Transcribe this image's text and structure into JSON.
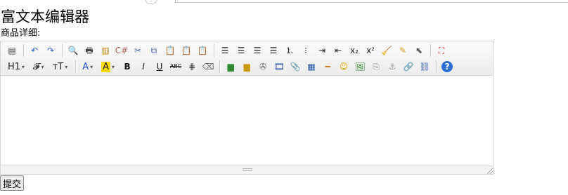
{
  "page": {
    "title": "富文本编辑器",
    "field_label": "商品详细:"
  },
  "editor": {
    "toolbar": {
      "row1": [
        {
          "name": "source-icon",
          "glyph": "▤",
          "color": "#444"
        },
        {
          "sep": true
        },
        {
          "name": "undo-icon",
          "glyph": "↶",
          "color": "#2a62c9"
        },
        {
          "name": "redo-icon",
          "glyph": "↷",
          "color": "#2a62c9"
        },
        {
          "sep": true
        },
        {
          "name": "preview-icon",
          "glyph": "🔍",
          "color": "#666"
        },
        {
          "name": "print-icon",
          "glyph": "🖶",
          "color": "#444"
        },
        {
          "name": "template-icon",
          "glyph": "▥",
          "color": "#c98a12"
        },
        {
          "name": "code-icon",
          "glyph": "C#",
          "color": "#b66"
        },
        {
          "name": "cut-icon",
          "glyph": "✂",
          "color": "#4b6fb8"
        },
        {
          "name": "copy-icon",
          "glyph": "⧉",
          "color": "#4b6fb8"
        },
        {
          "name": "paste-icon",
          "glyph": "📋",
          "color": "#a8731c"
        },
        {
          "name": "paste-text-icon",
          "glyph": "📋",
          "color": "#a8731c"
        },
        {
          "name": "paste-word-icon",
          "glyph": "📋",
          "color": "#2b56a8"
        },
        {
          "sep": true
        },
        {
          "name": "align-left-icon",
          "glyph": "☰",
          "color": "#222"
        },
        {
          "name": "align-center-icon",
          "glyph": "☰",
          "color": "#222"
        },
        {
          "name": "align-right-icon",
          "glyph": "☰",
          "color": "#222"
        },
        {
          "name": "align-justify-icon",
          "glyph": "☰",
          "color": "#222"
        },
        {
          "name": "ordered-list-icon",
          "glyph": "⒈",
          "color": "#222"
        },
        {
          "name": "unordered-list-icon",
          "glyph": "⁝",
          "color": "#222"
        },
        {
          "name": "indent-icon",
          "glyph": "⇥",
          "color": "#222"
        },
        {
          "name": "outdent-icon",
          "glyph": "⇤",
          "color": "#222"
        },
        {
          "name": "subscript-icon",
          "glyph": "x₂",
          "color": "#222"
        },
        {
          "name": "superscript-icon",
          "glyph": "x²",
          "color": "#222"
        },
        {
          "name": "clear-format-icon",
          "glyph": "🧹",
          "color": "#d89b1a"
        },
        {
          "name": "quick-format-icon",
          "glyph": "✎",
          "color": "#d89b1a"
        },
        {
          "name": "select-all-icon",
          "glyph": "⬉",
          "color": "#555"
        },
        {
          "sep": true
        },
        {
          "name": "fullscreen-icon",
          "glyph": "⛶",
          "color": "#d22"
        }
      ],
      "row2_combos": [
        {
          "name": "heading-combo",
          "label": "H1",
          "caret": "▾"
        },
        {
          "name": "font-family-combo",
          "label": "𝓕",
          "caret": "▾"
        },
        {
          "name": "font-size-combo",
          "label": "ᴛT",
          "caret": "▾"
        }
      ],
      "row2_color": [
        {
          "name": "font-color-combo",
          "label": "A",
          "caret": "▾",
          "color": "#2b56c9",
          "hl": false
        },
        {
          "name": "bg-color-combo",
          "label": "A",
          "caret": "▾",
          "color": "#222",
          "hl": true
        }
      ],
      "row2": [
        {
          "name": "bold-icon",
          "glyph": "B",
          "color": "#111",
          "weight": "bold"
        },
        {
          "name": "italic-icon",
          "glyph": "I",
          "color": "#111",
          "style": "italic"
        },
        {
          "name": "underline-icon",
          "glyph": "U",
          "color": "#111",
          "deco": "underline"
        },
        {
          "name": "strikethrough-icon",
          "glyph": "ABC",
          "color": "#111",
          "deco": "line-through",
          "small": true
        },
        {
          "name": "table-lines-icon",
          "glyph": "⋕",
          "color": "#333"
        },
        {
          "name": "eraser-icon",
          "glyph": "⌫",
          "color": "#666"
        },
        {
          "sep": true
        },
        {
          "name": "insert-image-icon",
          "glyph": "▆",
          "color": "#2f8a2f"
        },
        {
          "name": "insert-flash-icon",
          "glyph": "▆",
          "color": "#c99a12"
        },
        {
          "name": "insert-media-icon",
          "glyph": "✇",
          "color": "#666"
        },
        {
          "name": "insert-video-icon",
          "glyph": "🎞",
          "color": "#2b56a8"
        },
        {
          "name": "attachment-icon",
          "glyph": "📎",
          "color": "#777"
        },
        {
          "name": "insert-table-icon",
          "glyph": "▦",
          "color": "#2b56a8"
        },
        {
          "name": "horizontal-rule-icon",
          "glyph": "━",
          "color": "#c97a12"
        },
        {
          "name": "emoticon-icon",
          "glyph": "☺",
          "color": "#e5a800"
        },
        {
          "name": "image-icon",
          "glyph": "🖼",
          "color": "#2f8a2f"
        },
        {
          "name": "page-break-icon",
          "glyph": "⎘",
          "color": "#999"
        },
        {
          "name": "anchor-icon",
          "glyph": "⚓",
          "color": "#999"
        },
        {
          "name": "link-icon",
          "glyph": "🔗",
          "color": "#2b56a8"
        },
        {
          "name": "unlink-icon",
          "glyph": "⛓",
          "color": "#2b56a8"
        },
        {
          "sep": true
        },
        {
          "name": "help-icon",
          "glyph": "?",
          "color": "#fff",
          "bg": "#2b6fd1",
          "round": true
        }
      ]
    },
    "content": ""
  },
  "submit": {
    "label": "提交"
  }
}
